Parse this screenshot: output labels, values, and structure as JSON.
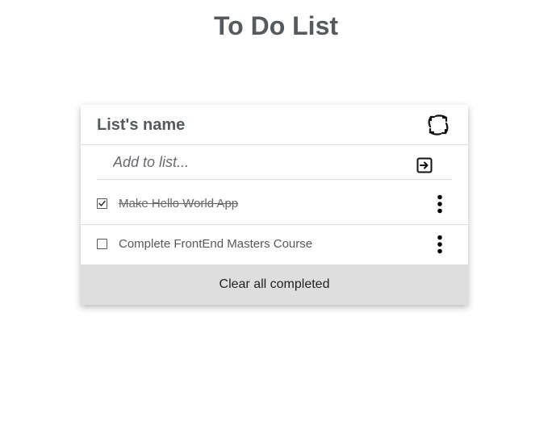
{
  "page": {
    "title": "To Do List"
  },
  "list": {
    "name": "List's name",
    "refresh_icon": "refresh-icon"
  },
  "add": {
    "placeholder": "Add to list...",
    "value": "",
    "submit_icon": "enter-icon"
  },
  "items": [
    {
      "text": "Make Hello World App",
      "completed": true,
      "menu_icon": "more-vertical-icon"
    },
    {
      "text": "Complete FrontEnd Masters Course",
      "completed": false,
      "menu_icon": "more-vertical-icon"
    }
  ],
  "footer": {
    "clear_label": "Clear all completed"
  },
  "colors": {
    "title": "#555a5e",
    "clear_button_bg": "#dedede",
    "divider": "#dcdcdc"
  }
}
